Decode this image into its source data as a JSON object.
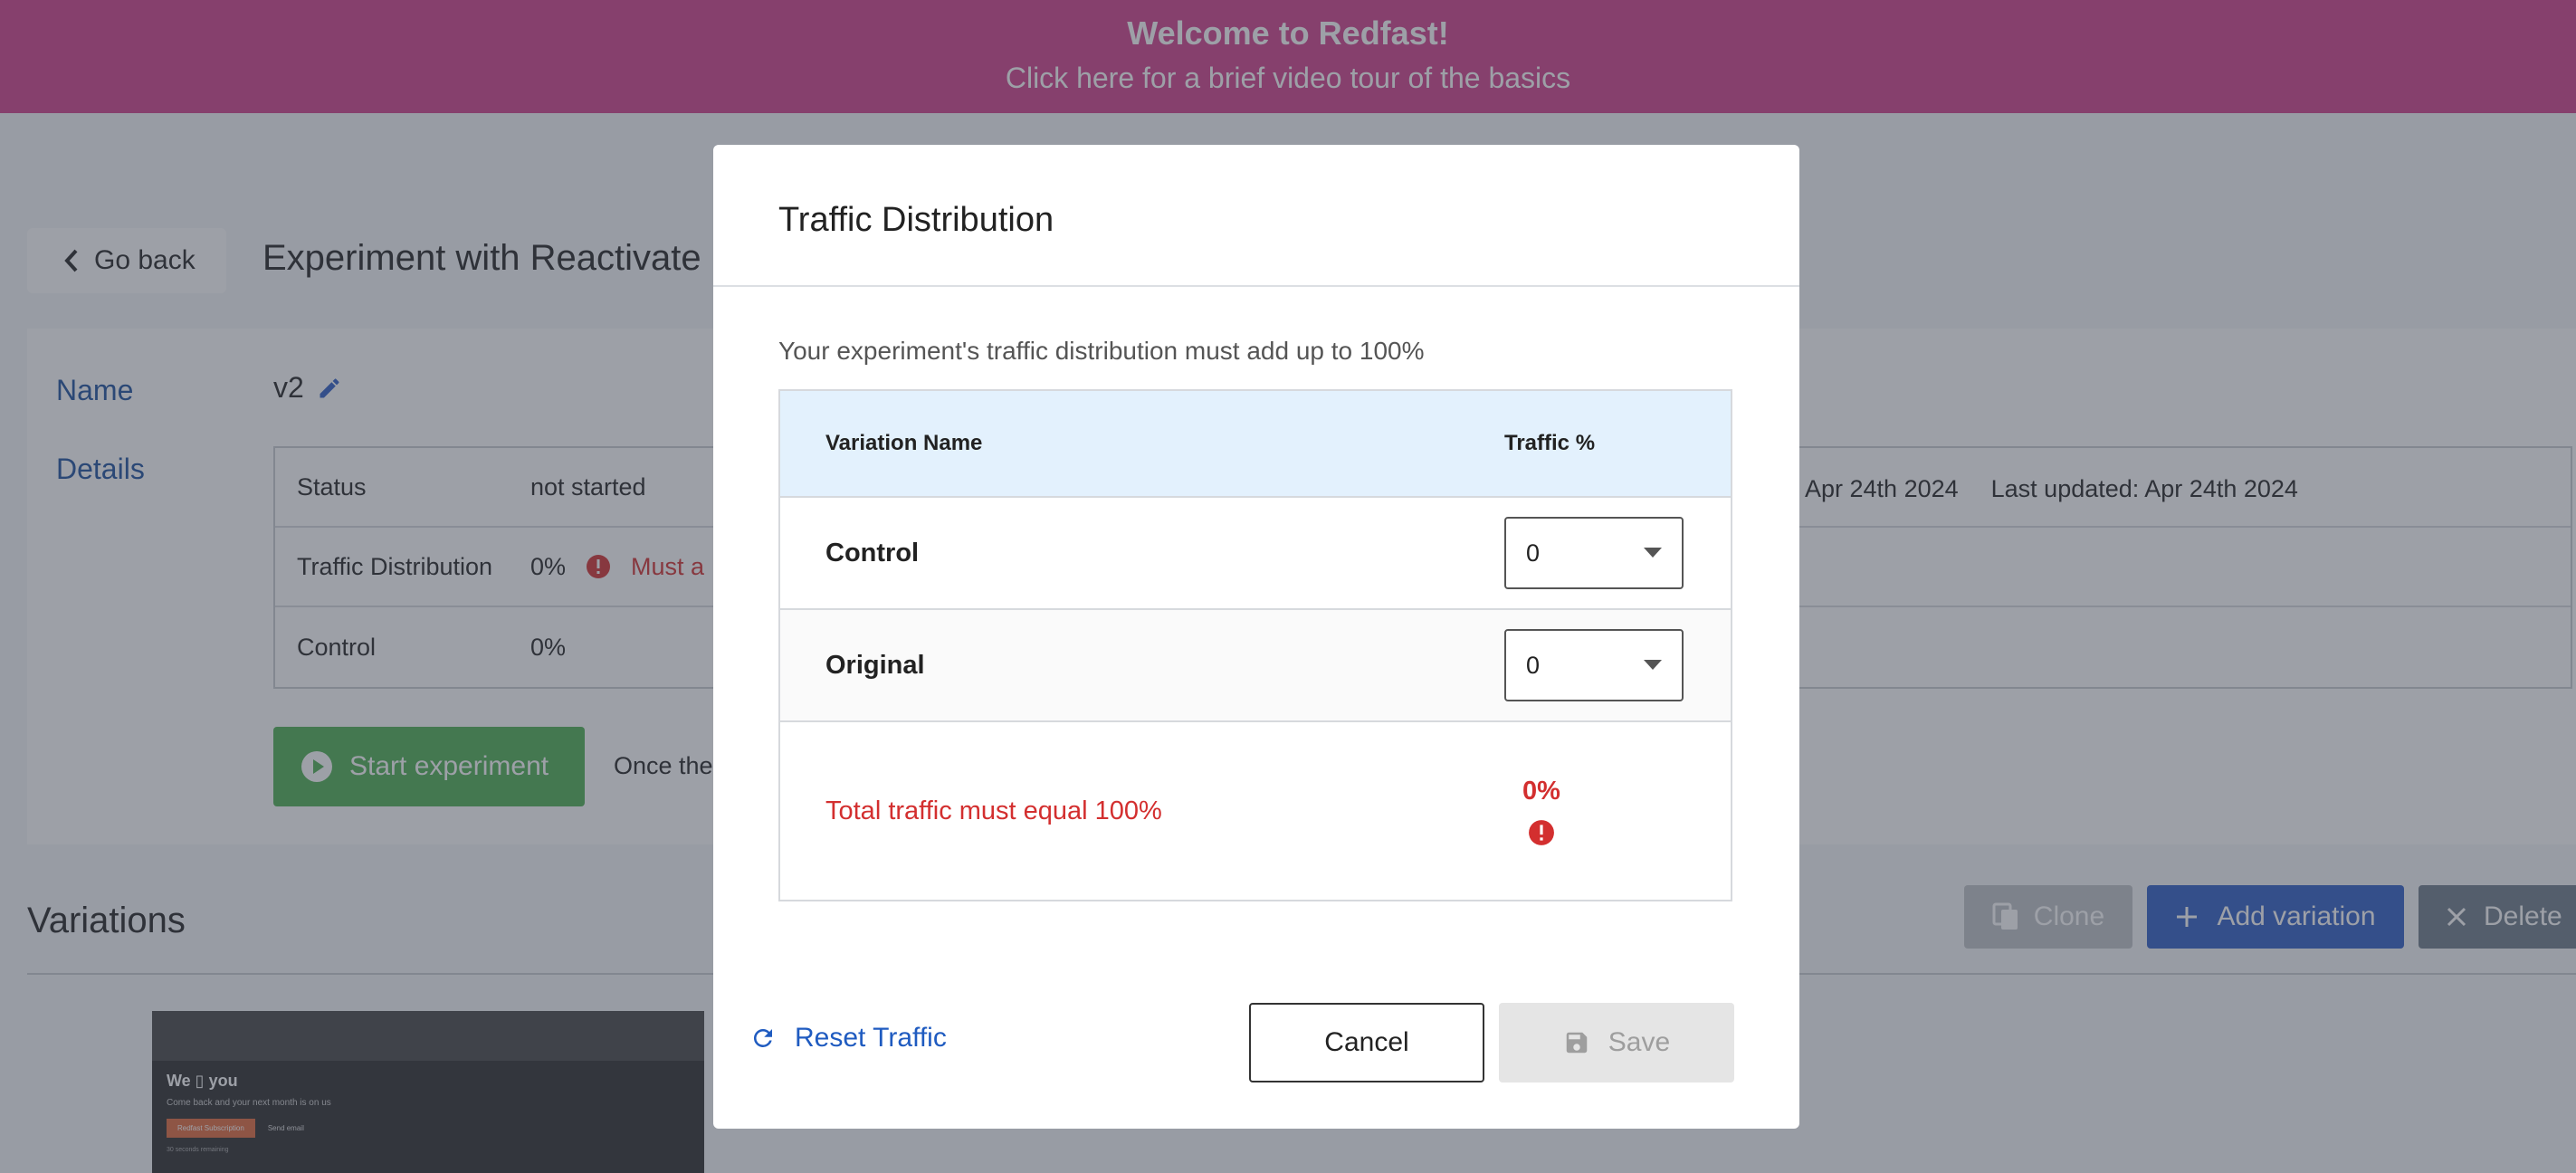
{
  "banner": {
    "title": "Welcome to Redfast!",
    "subtitle": "Click here for a brief video tour of the basics"
  },
  "header": {
    "back_label": "Go back",
    "experiment_title": "Experiment with Reactivate"
  },
  "details_card": {
    "name_label": "Name",
    "name_value": "v2",
    "details_label": "Details",
    "rows": [
      {
        "label": "Status",
        "value": "not started"
      },
      {
        "label": "Traffic Distribution",
        "value": "0%",
        "warning": "Must a"
      },
      {
        "label": "Control",
        "value": "0%"
      }
    ],
    "created": "Apr 24th 2024",
    "last_updated": "Last updated: Apr 24th 2024",
    "start_button": "Start experiment",
    "start_note": "Once the"
  },
  "variations": {
    "title": "Variations",
    "clone_label": "Clone",
    "add_label": "Add variation",
    "delete_label": "Delete",
    "thumbnail": {
      "heading": "We ▯ you",
      "text": "Come back and your next month is on us",
      "primary": "Redfast Subscription",
      "secondary": "Send email",
      "footer": "30 seconds remaining"
    }
  },
  "modal": {
    "title": "Traffic Distribution",
    "description": "Your experiment's traffic distribution must add up to 100%",
    "col_name": "Variation Name",
    "col_traffic": "Traffic %",
    "rows": [
      {
        "name": "Control",
        "value": "0"
      },
      {
        "name": "Original",
        "value": "0"
      }
    ],
    "total_message": "Total traffic must equal 100%",
    "total_value": "0%",
    "reset_label": "Reset Traffic",
    "cancel_label": "Cancel",
    "save_label": "Save"
  },
  "colors": {
    "banner": "#d13f8a",
    "primary": "#2c5cc5",
    "error": "#d32f2f",
    "success": "#4caf50"
  }
}
